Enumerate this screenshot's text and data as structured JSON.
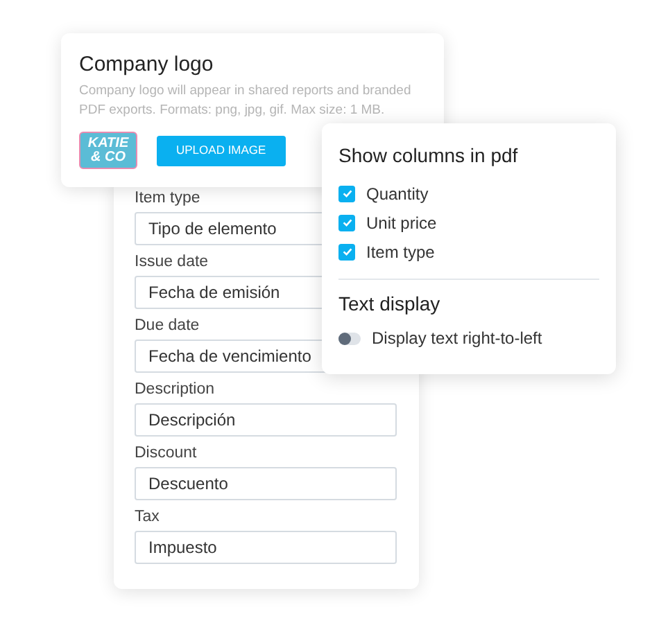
{
  "logo_card": {
    "title": "Company logo",
    "description": "Company logo will appear in shared reports and branded PDF exports. Formats: png, jpg, gif. Max size: 1 MB.",
    "logo_text": [
      "KATIE",
      "& CO"
    ],
    "upload_button": "UPLOAD IMAGE"
  },
  "fields": [
    {
      "label": "Item type",
      "value": "Tipo de elemento"
    },
    {
      "label": "Issue date",
      "value": "Fecha de emisión"
    },
    {
      "label": "Due date",
      "value": "Fecha de vencimiento"
    },
    {
      "label": "Description",
      "value": "Descripción"
    },
    {
      "label": "Discount",
      "value": "Descuento"
    },
    {
      "label": "Tax",
      "value": "Impuesto"
    }
  ],
  "pdf_panel": {
    "columns_title": "Show columns in pdf",
    "columns": [
      {
        "label": "Quantity",
        "checked": true
      },
      {
        "label": "Unit price",
        "checked": true
      },
      {
        "label": "Item type",
        "checked": true
      }
    ],
    "text_display_title": "Text display",
    "rtl_toggle": {
      "label": "Display text right-to-left",
      "on": false
    }
  }
}
